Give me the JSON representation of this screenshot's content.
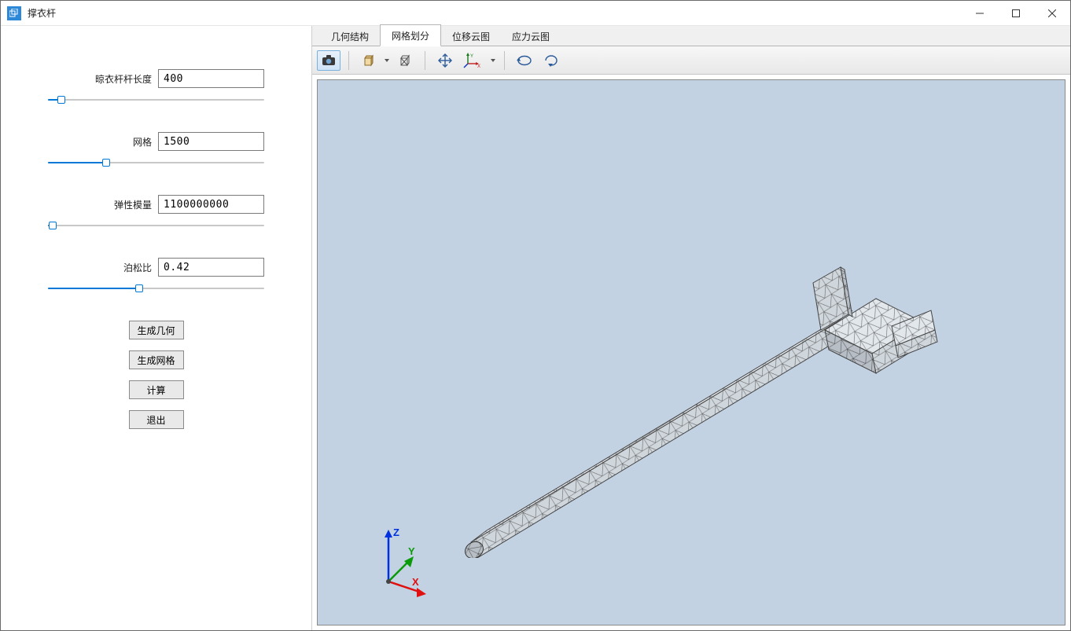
{
  "window": {
    "title": "撑衣杆"
  },
  "params": {
    "length": {
      "label": "晾衣杆杆长度",
      "value": "400",
      "pos": 6
    },
    "mesh": {
      "label": "网格",
      "value": "1500",
      "pos": 27
    },
    "modulus": {
      "label": "弹性模量",
      "value": "1100000000",
      "pos": 2
    },
    "poisson": {
      "label": "泊松比",
      "value": "0.42",
      "pos": 42
    }
  },
  "actions": {
    "gen_geom": "生成几何",
    "gen_mesh": "生成网格",
    "compute": "计算",
    "exit": "退出"
  },
  "tabs": {
    "geometry": "几何结构",
    "mesh": "网格划分",
    "displacement": "位移云图",
    "stress": "应力云图",
    "active": "mesh"
  },
  "toolbar": {
    "camera": "camera-icon",
    "box": "box-icon",
    "wireframe": "wireframe-icon",
    "pan": "pan-icon",
    "axes": "axes-icon",
    "rotate_l": "rotate-left-icon",
    "rotate_r": "rotate-right-icon",
    "axes_label_x": "X",
    "axes_label_y": "Y"
  },
  "triad": {
    "x": "X",
    "y": "Y",
    "z": "Z"
  }
}
